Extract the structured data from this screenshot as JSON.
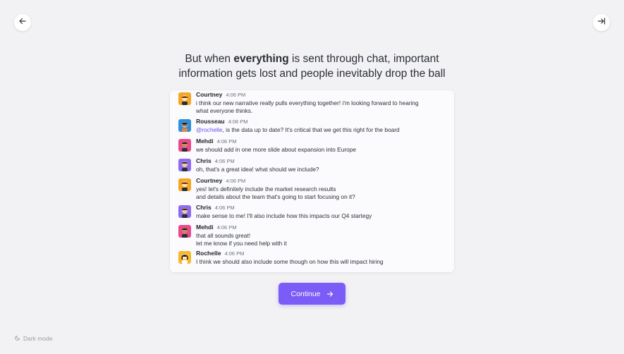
{
  "nav": {
    "back_icon": "arrow-left-icon",
    "skip_icon": "arrow-right-to-bar-icon"
  },
  "headline": {
    "part1": "But when ",
    "bold": "everything",
    "part2": " is sent through chat, important",
    "line2": "information gets lost and people inevitably drop the ball"
  },
  "messages": [
    {
      "author": "Courtney",
      "time": "4:06 PM",
      "avatar_color": "#f5a623",
      "lines": [
        "i think our new narrative really pulls everything together! i'm looking forward to hearing",
        "what everyone thinks."
      ]
    },
    {
      "author": "Rousseau",
      "time": "4:06 PM",
      "avatar_color": "#2f8fd8",
      "mention": "@rochelle",
      "lines": [
        ", is the data up to date? It's critical that we get this right for the board"
      ]
    },
    {
      "author": "Mehdi",
      "time": "4:06 PM",
      "avatar_color": "#e94b8a",
      "lines": [
        "we should add in one more slide about expansion into Europe"
      ]
    },
    {
      "author": "Chris",
      "time": "4:06 PM",
      "avatar_color": "#8b6cf0",
      "lines": [
        "oh, that's a great idea! what should we include?"
      ]
    },
    {
      "author": "Courtney",
      "time": "4:06 PM",
      "avatar_color": "#f5a623",
      "lines": [
        "yes! let's definitely include the market research results",
        "and details about the team that's going to start focusing on it?"
      ]
    },
    {
      "author": "Chris",
      "time": "4:06 PM",
      "avatar_color": "#8b6cf0",
      "lines": [
        "make sense to me! I'll also include how this impacts our Q4 startegy"
      ]
    },
    {
      "author": "Mehdi",
      "time": "4:06 PM",
      "avatar_color": "#e94b8a",
      "lines": [
        "that all sounds great!",
        "let me know if you need help with it"
      ]
    },
    {
      "author": "Rochelle",
      "time": "4:06 PM",
      "avatar_color": "#f5b82e",
      "lines": [
        "I think we should also include some though on how this will impact hiring"
      ]
    }
  ],
  "continue_button": {
    "label": "Continue",
    "icon": "arrow-right-icon"
  },
  "dark_mode": {
    "label": "Dark mode",
    "icon": "moon-icon"
  },
  "colors": {
    "accent": "#7b5cf6",
    "mention": "#6a4df5",
    "background": "#f2f2f4"
  }
}
